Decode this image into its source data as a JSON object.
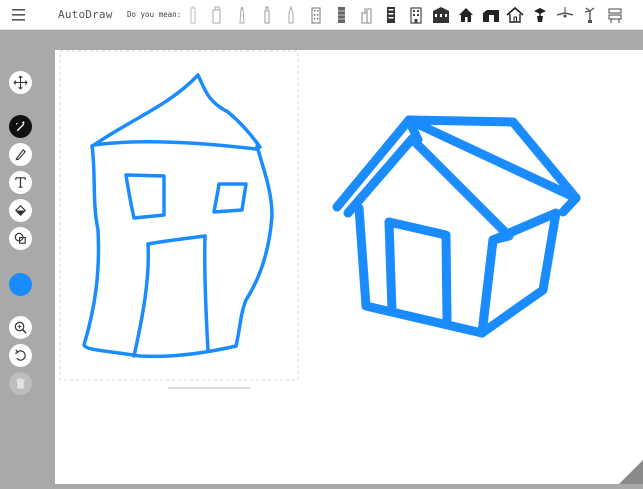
{
  "app": {
    "title": "AutoDraw"
  },
  "suggestions": {
    "label": "Do you mean:",
    "items": [
      {
        "icon": "tall-building-icon"
      },
      {
        "icon": "tower-building-icon"
      },
      {
        "icon": "lighthouse-icon"
      },
      {
        "icon": "skyscraper-icon"
      },
      {
        "icon": "rocket-tower-icon"
      },
      {
        "icon": "apartment-building-icon"
      },
      {
        "icon": "office-tower-icon"
      },
      {
        "icon": "city-building-icon"
      },
      {
        "icon": "hotel-building-icon"
      },
      {
        "icon": "block-building-icon"
      },
      {
        "icon": "townhouse-icon"
      },
      {
        "icon": "house-icon"
      },
      {
        "icon": "barn-icon"
      },
      {
        "icon": "cottage-icon"
      },
      {
        "icon": "potted-plant-icon"
      },
      {
        "icon": "ceiling-fan-icon"
      },
      {
        "icon": "palm-plant-icon"
      },
      {
        "icon": "train-station-icon"
      }
    ]
  },
  "tools": [
    {
      "name": "move-tool",
      "icon": "move-arrows-icon",
      "state": "normal"
    },
    {
      "name": "autodraw-tool",
      "icon": "magic-pencil-icon",
      "state": "active"
    },
    {
      "name": "draw-tool",
      "icon": "pencil-icon",
      "state": "normal"
    },
    {
      "name": "type-tool",
      "icon": "text-t-icon",
      "state": "normal"
    },
    {
      "name": "fill-tool",
      "icon": "paint-bucket-icon",
      "state": "normal"
    },
    {
      "name": "shape-tool",
      "icon": "shapes-icon",
      "state": "normal"
    },
    {
      "name": "zoom-tool",
      "icon": "magnifier-icon",
      "state": "normal"
    },
    {
      "name": "undo-tool",
      "icon": "undo-icon",
      "state": "normal"
    },
    {
      "name": "delete-tool",
      "icon": "trash-icon",
      "state": "disabled"
    }
  ],
  "colors": {
    "stroke": "#1a8cff",
    "active_color": "#1a8cff",
    "panel": "#a9a9a9",
    "dashed_box": "#d6d6d6"
  }
}
